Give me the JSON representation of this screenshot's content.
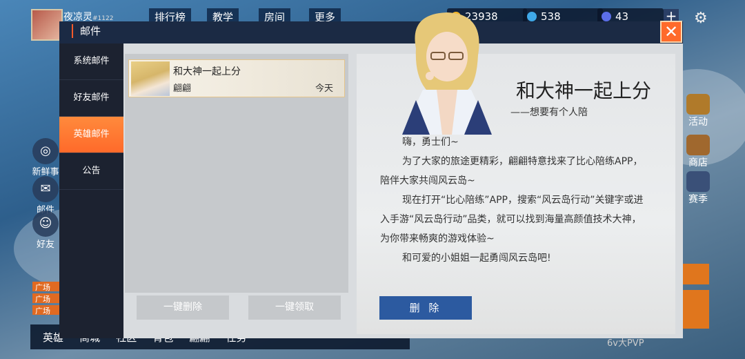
{
  "hud": {
    "player_name": "夜凉灵",
    "player_id": "#1122",
    "top_buttons": [
      "排行榜",
      "教学",
      "房间",
      "更多"
    ],
    "gold": "23938",
    "gems": "538",
    "tickets": "43",
    "left_side": [
      "新鲜事",
      "邮件",
      "好友"
    ],
    "right_side": [
      "活动",
      "商店",
      "赛季"
    ],
    "bottom_bar": [
      "英雄",
      "商城",
      "社区",
      "背包",
      "翩翩",
      "任务"
    ],
    "chat_tag": "广场",
    "pvp_label": "6v大PVP"
  },
  "modal": {
    "title": "邮件",
    "close_icon": "close-icon",
    "tabs": [
      "系统邮件",
      "好友邮件",
      "英雄邮件",
      "公告"
    ],
    "active_tab": 2,
    "mail_list": [
      {
        "title": "和大神一起上分",
        "sender": "翩翩",
        "date": "今天"
      }
    ],
    "delete_all_label": "一键删除",
    "claim_all_label": "一键领取",
    "detail": {
      "title": "和大神一起上分",
      "subtitle": "——想要有个人陪",
      "paragraphs": [
        "嗨，勇士们~",
        "为了大家的旅途更精彩，翩翩特意找来了比心陪练APP，陪伴大家共闯风云岛~",
        "现在打开“比心陪练”APP，搜索“风云岛行动”关键字或进入手游“风云岛行动”品类，就可以找到海量高颜值技术大神，为你带来畅爽的游戏体验~",
        "和可爱的小姐姐一起勇闯风云岛吧!"
      ],
      "delete_label": "删 除"
    }
  }
}
